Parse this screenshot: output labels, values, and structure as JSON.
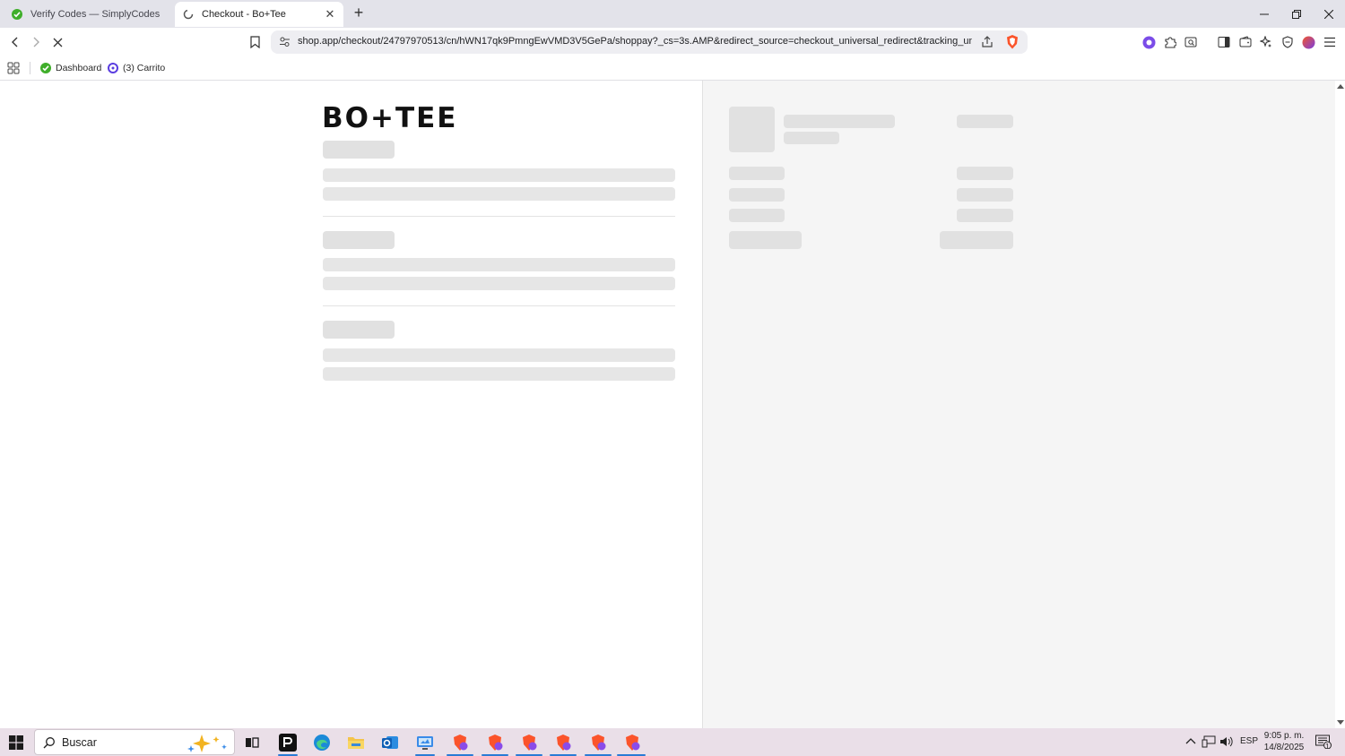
{
  "browser": {
    "tabs": [
      {
        "title": "Verify Codes — SimplyCodes",
        "active": false
      },
      {
        "title": "Checkout - Bo+Tee",
        "active": true
      }
    ],
    "url": "shop.app/checkout/24797970513/cn/hWN17qk9PmngEwVMD3V5GePa/shoppay?_cs=3s.AMP&redirect_source=checkout_universal_redirect&tracking_uni...",
    "bookmarks": [
      {
        "label": "Dashboard"
      },
      {
        "label": "(3) Carrito"
      }
    ]
  },
  "page": {
    "brand_logo": "BO+TEE",
    "loading": true
  },
  "taskbar": {
    "search_placeholder": "Buscar",
    "language": "ESP",
    "time": "9:05 p. m.",
    "date": "14/8/2025",
    "notification_count": "1"
  },
  "colors": {
    "tab_strip": "#e3e3ea",
    "omnibox": "#eeeef2",
    "skeleton": "#e6e6e6",
    "summary_panel": "#f5f5f5",
    "taskbar": "#eadfe8",
    "brave_orange": "#fb542b"
  }
}
